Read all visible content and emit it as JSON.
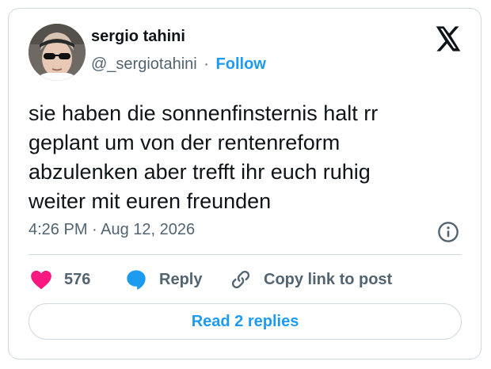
{
  "author": {
    "display_name": "sergio tahini",
    "handle": "@_sergiotahini",
    "separator": "·",
    "follow_label": "Follow"
  },
  "platform_icon": "x-logo-icon",
  "tweet": {
    "lines": [
      "sie haben die sonnenfinsternis halt rr",
      "geplant um von der rentenreform",
      "abzulenken aber trefft ihr euch ruhig",
      "weiter mit euren freunden"
    ],
    "timestamp": "4:26 PM · Aug 12, 2026"
  },
  "actions": {
    "like_count": "576",
    "reply_label": "Reply",
    "copy_label": "Copy link to post"
  },
  "read_replies_label": "Read 2 replies",
  "colors": {
    "accent": "#1d9bf0",
    "like": "#f91880",
    "muted": "#536471",
    "text": "#0f1419",
    "border": "#cfd9de"
  },
  "icons": [
    "x-logo-icon",
    "info-icon",
    "heart-icon",
    "speech-bubble-icon",
    "link-icon"
  ]
}
